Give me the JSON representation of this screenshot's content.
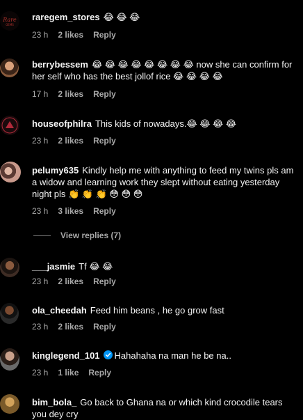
{
  "emoji_glyph": "😂",
  "colors": {
    "background": "#000000",
    "text": "#f5f5f5",
    "meta": "#a8a8a8",
    "verified": "#0095f6"
  },
  "labels": {
    "reply": "Reply"
  },
  "comments": [
    {
      "username": "raregem_stores",
      "text": "😂 😂 😂",
      "time": "23 h",
      "likes": "2 likes",
      "avatar": "raregem-logo-avatar"
    },
    {
      "username": "berrybessem",
      "text": "😂 😂 😂 😂 😂 😂 😂 😂  now she can confirm for her self who has the best jollof rice 😂 😂 😂 😂",
      "time": "17 h",
      "likes": "2 likes",
      "avatar": "woman-avatar"
    },
    {
      "username": "houseofphilra",
      "text": "This kids of nowadays.😂 😂 😂 😂",
      "time": "23 h",
      "likes": "2 likes",
      "avatar": "houseofphilra-logo-avatar"
    },
    {
      "username": "pelumy635",
      "text": "Kindly help me with anything to feed my twins pls am a widow and learning work they slept without eating yesterday night pls 👏 👏 👏 😳 😳 😳",
      "time": "23 h",
      "likes": "3 likes",
      "avatar": "woman-avatar"
    },
    {
      "username": "___jasmie",
      "text": "Tf 😂 😂",
      "time": "23 h",
      "likes": "2 likes",
      "avatar": "woman-avatar"
    },
    {
      "username": "ola_cheedah",
      "text": "Feed him beans , he go grow fast",
      "time": "23 h",
      "likes": "2 likes",
      "avatar": "woman-avatar"
    },
    {
      "username": "kinglegend_101",
      "text": "Hahahaha na man he be na..",
      "time": "23 h",
      "likes": "1 like",
      "verified": true,
      "avatar": "man-avatar"
    },
    {
      "username": "bim_bola_",
      "text": "Go back to Ghana na or which kind crocodile tears you dey cry",
      "avatar": "woman-avatar"
    }
  ],
  "view_replies": "View replies (7)"
}
